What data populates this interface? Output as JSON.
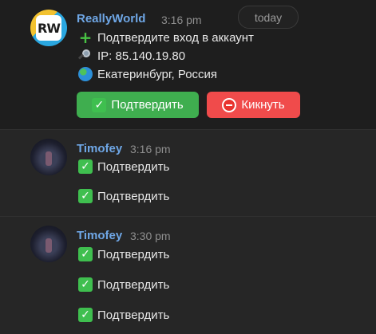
{
  "date_divider": "today",
  "messages": [
    {
      "author": "ReallyWorld",
      "time": "3:16 pm",
      "avatar_text": "RW",
      "lines": [
        {
          "icon": "plus-icon",
          "text": "Подтвердите вход в аккаунт"
        },
        {
          "icon": "magnifier-icon",
          "text": "IP: 85.140.19.80"
        },
        {
          "icon": "globe-icon",
          "text": "Екатеринбург, Россия"
        }
      ],
      "buttons": [
        {
          "icon": "check-icon",
          "label": "Подтвердить",
          "color": "#3fae4f"
        },
        {
          "icon": "no-entry-icon",
          "label": "Кикнуть",
          "color": "#f04b4b"
        }
      ]
    },
    {
      "author": "Timofey",
      "time": "3:16 pm",
      "lines": [
        {
          "icon": "check-icon",
          "text": "Подтвердить"
        },
        {
          "icon": "check-icon",
          "text": "Подтвердить"
        }
      ]
    },
    {
      "author": "Timofey",
      "time": "3:30 pm",
      "lines": [
        {
          "icon": "check-icon",
          "text": "Подтвердить"
        },
        {
          "icon": "check-icon",
          "text": "Подтвердить"
        },
        {
          "icon": "check-icon",
          "text": "Подтвердить"
        }
      ]
    }
  ],
  "colors": {
    "author_name": "#6fa7e6",
    "confirm_button": "#3fae4f",
    "kick_button": "#f04b4b",
    "check_emoji": "#3fbf4f"
  }
}
